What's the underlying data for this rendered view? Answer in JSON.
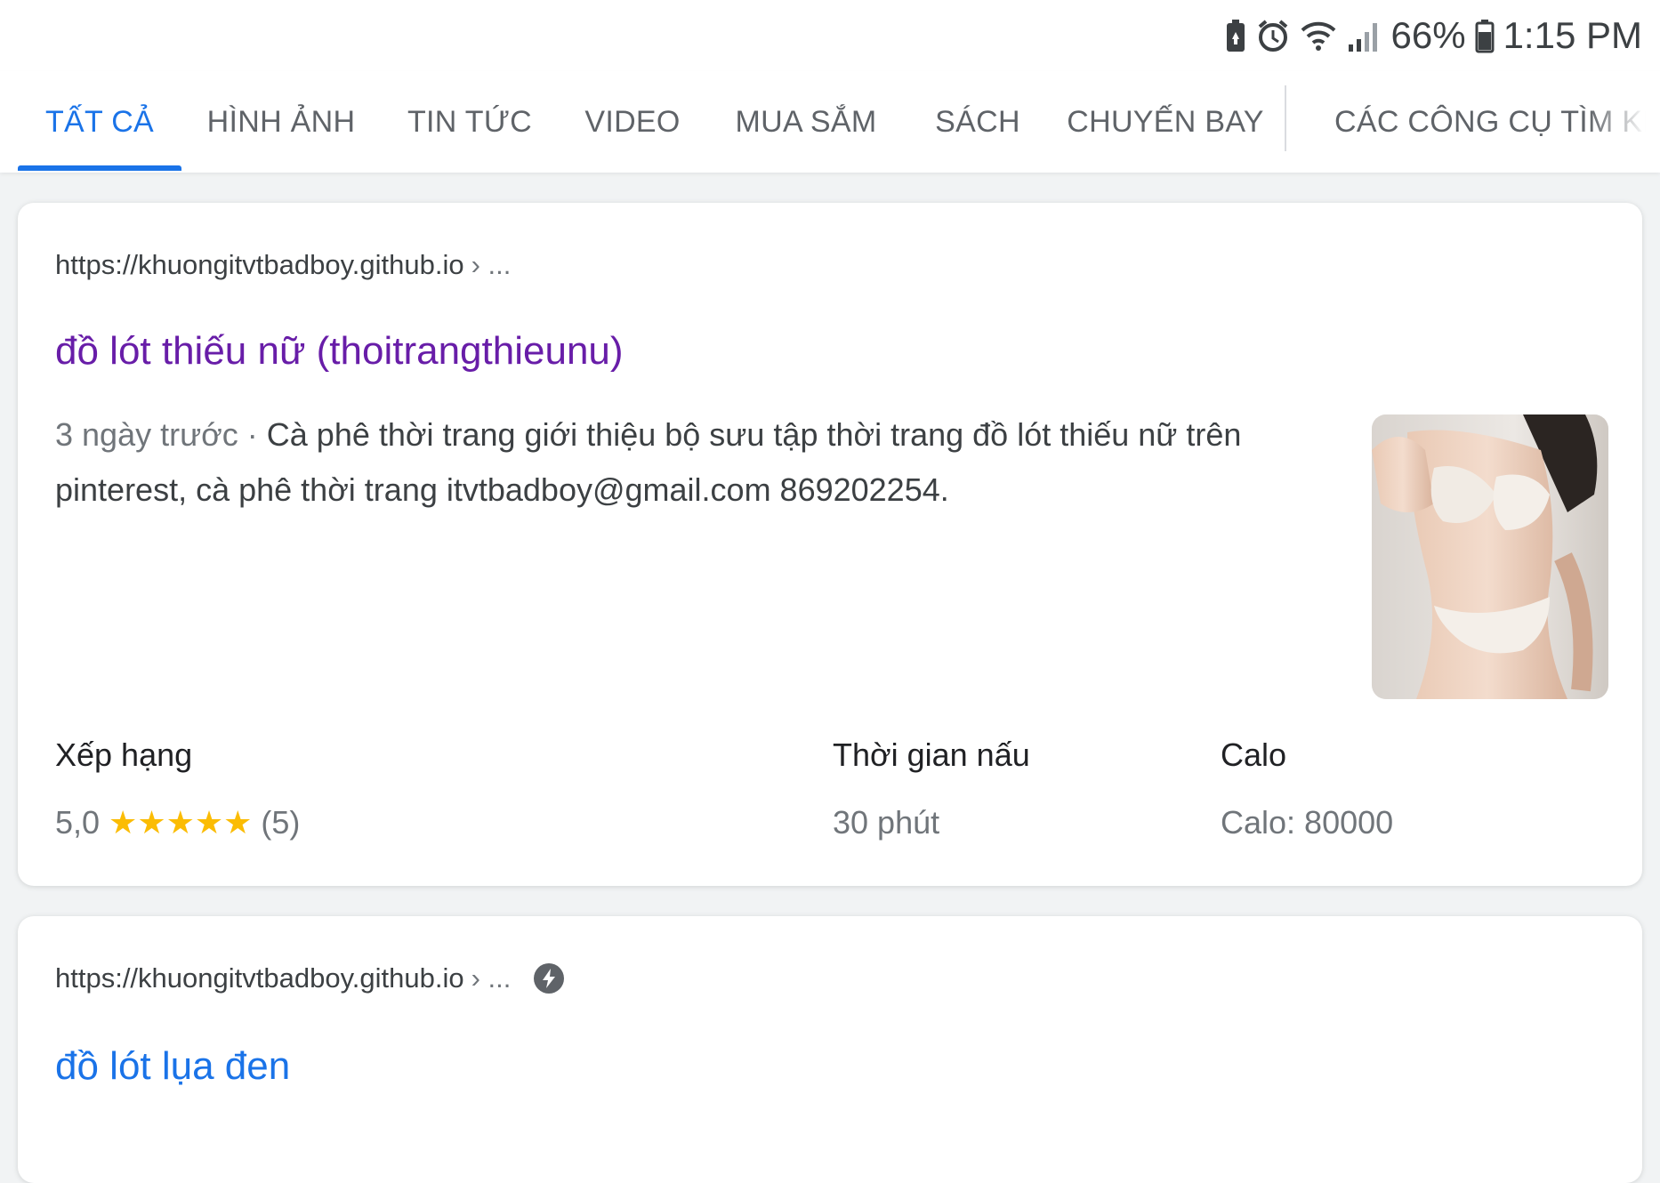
{
  "status_bar": {
    "battery_percent": "66%",
    "time": "1:15 PM"
  },
  "tabs": [
    {
      "label": "TẤT CẢ",
      "active": true
    },
    {
      "label": "HÌNH ẢNH",
      "active": false
    },
    {
      "label": "TIN TỨC",
      "active": false
    },
    {
      "label": "VIDEO",
      "active": false
    },
    {
      "label": "MUA SẮM",
      "active": false
    },
    {
      "label": "SÁCH",
      "active": false
    },
    {
      "label": "CHUYẾN BAY",
      "active": false
    },
    {
      "label": "CÁC CÔNG CỤ TÌM KIẾM",
      "active": false
    }
  ],
  "results": [
    {
      "url": "https://khuongitvtbadboy.github.io",
      "breadcrumb": "› ...",
      "title": "đồ lót thiếu nữ (thoitrangthieunu)",
      "date": "3 ngày trước · ",
      "snippet": "Cà phê thời trang giới thiệu bộ sưu tập thời trang đồ lót thiếu nữ trên pinterest, cà phê thời trang itvtbadboy@gmail.com 869202254.",
      "rating_label": "Xếp hạng",
      "rating_value": "5,0",
      "rating_stars": 5,
      "rating_stars_glyphs": "★★★★★",
      "rating_count": "(5)",
      "time_label": "Thời gian nấu",
      "time_value": "30 phút",
      "calo_label": "Calo",
      "calo_value": "Calo: 80000"
    },
    {
      "url": "https://khuongitvtbadboy.github.io",
      "breadcrumb": "› ...",
      "amp_icon": "amp-lightning-icon",
      "title": "đồ lót lụa đen"
    }
  ],
  "colors": {
    "accent": "#1a73e8",
    "visited_link": "#681da8",
    "star": "#fbbc04"
  }
}
